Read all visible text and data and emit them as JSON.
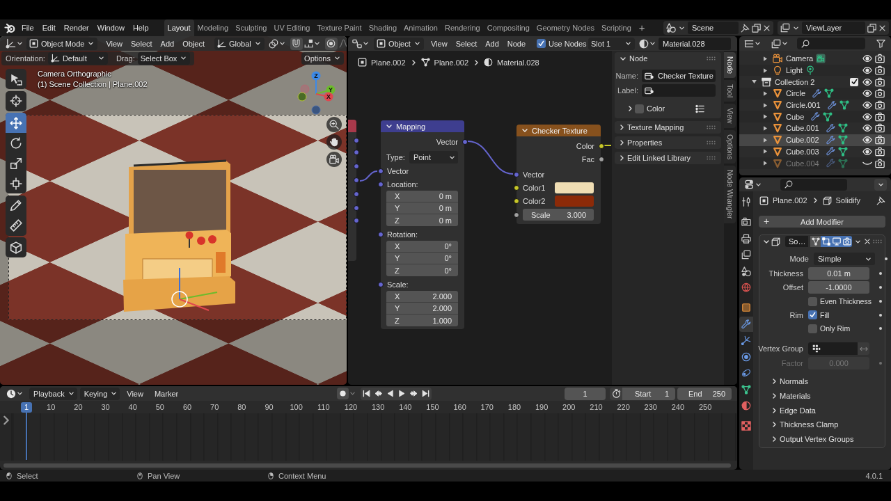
{
  "topbar": {
    "menus": [
      "File",
      "Edit",
      "Render",
      "Window",
      "Help"
    ],
    "workspaces": [
      {
        "label": "Layout",
        "selected": true
      },
      {
        "label": "Modeling",
        "selected": false
      },
      {
        "label": "Sculpting",
        "selected": false
      },
      {
        "label": "UV Editing",
        "selected": false
      },
      {
        "label": "Texture Paint",
        "selected": false
      },
      {
        "label": "Shading",
        "selected": false
      },
      {
        "label": "Animation",
        "selected": false
      },
      {
        "label": "Rendering",
        "selected": false
      },
      {
        "label": "Compositing",
        "selected": false
      },
      {
        "label": "Geometry Nodes",
        "selected": false
      },
      {
        "label": "Scripting",
        "selected": false
      }
    ],
    "add_workspace": "+",
    "scene": "Scene",
    "view_layer": "ViewLayer"
  },
  "viewport": {
    "header": {
      "mode": "Object Mode",
      "menus": [
        "View",
        "Select",
        "Add",
        "Object"
      ],
      "orientation": "Global"
    },
    "tool_settings": {
      "orientation_label": "Orientation:",
      "orientation": "Default",
      "drag_label": "Drag:",
      "drag": "Select Box",
      "options": "Options"
    },
    "overlay_text": [
      "Camera Orthographic",
      "(1) Scene Collection | Plane.002"
    ],
    "gizmo_axes": [
      "Z",
      "Y",
      "X"
    ],
    "tool_groups": [
      [
        {
          "kind": "select_box",
          "selected": false
        }
      ],
      [
        {
          "kind": "cursor",
          "selected": false
        }
      ],
      [
        {
          "kind": "move",
          "selected": true
        },
        {
          "kind": "rotate",
          "selected": false
        },
        {
          "kind": "scale",
          "selected": false
        },
        {
          "kind": "transform",
          "selected": false
        }
      ],
      [
        {
          "kind": "annotate",
          "selected": false
        },
        {
          "kind": "measure",
          "selected": false
        }
      ],
      [
        {
          "kind": "add_cube",
          "selected": false
        }
      ]
    ]
  },
  "node_editor": {
    "header": {
      "context": "Object",
      "menus": [
        "View",
        "Select",
        "Add",
        "Node"
      ],
      "use_nodes": {
        "label": "Use Nodes",
        "checked": true
      },
      "slot": "Slot 1",
      "material": "Material.028"
    },
    "breadcrumbs": [
      {
        "kind": "object",
        "label": "Plane.002"
      },
      {
        "kind": "mesh",
        "label": "Plane.002"
      },
      {
        "kind": "material",
        "label": "Material.028"
      }
    ],
    "nodes": [
      {
        "kind": "vector",
        "title": "Mapping",
        "expanded": true,
        "rows": [
          {
            "kind": "output",
            "label": "Vector",
            "socket": {
              "kind": "vector"
            }
          },
          {
            "kind": "dropdown",
            "label": "Type:",
            "value": "Point"
          },
          {
            "kind": "input",
            "label": "Vector",
            "socket": {
              "kind": "vector"
            }
          },
          {
            "kind": "vector_group",
            "label": "Location:",
            "socket": {
              "kind": "vector"
            },
            "fields": [
              {
                "axis": "X",
                "value": "0 m"
              },
              {
                "axis": "Y",
                "value": "0 m"
              },
              {
                "axis": "Z",
                "value": "0 m"
              }
            ]
          },
          {
            "kind": "vector_group",
            "label": "Rotation:",
            "socket": {
              "kind": "vector"
            },
            "fields": [
              {
                "axis": "X",
                "value": "0°"
              },
              {
                "axis": "Y",
                "value": "0°"
              },
              {
                "axis": "Z",
                "value": "0°"
              }
            ]
          },
          {
            "kind": "vector_group",
            "label": "Scale:",
            "socket": {
              "kind": "vector"
            },
            "fields": [
              {
                "axis": "X",
                "value": "2.000"
              },
              {
                "axis": "Y",
                "value": "2.000"
              },
              {
                "axis": "Z",
                "value": "1.000"
              }
            ]
          }
        ]
      },
      {
        "kind": "texture",
        "title": "Checker Texture",
        "expanded": true,
        "rows": [
          {
            "kind": "output",
            "label": "Color",
            "socket": {
              "kind": "color"
            }
          },
          {
            "kind": "output",
            "label": "Fac",
            "socket": {
              "kind": "float"
            }
          },
          {
            "kind": "input",
            "label": "Vector",
            "socket": {
              "kind": "vector"
            }
          },
          {
            "kind": "color_input",
            "label": "Color1",
            "socket": {
              "kind": "color"
            },
            "color": "#f0deb4"
          },
          {
            "kind": "color_input",
            "label": "Color2",
            "socket": {
              "kind": "color"
            },
            "color": "#8c2a08"
          },
          {
            "kind": "value_input",
            "label": "Scale",
            "value": "3.000",
            "socket": {
              "kind": "float"
            }
          }
        ]
      }
    ],
    "sidebar": {
      "node_panel": {
        "title": "Node",
        "expanded": true,
        "name_label": "Name:",
        "name": "Checker Texture",
        "label_label": "Label:",
        "color_panel": {
          "label": "Color",
          "expanded": false,
          "checked": false
        }
      },
      "panels": [
        {
          "title": "Texture Mapping",
          "expanded": false
        },
        {
          "title": "Properties",
          "expanded": false
        },
        {
          "title": "Edit Linked Library",
          "expanded": false
        }
      ]
    },
    "sidebar_tabs": [
      {
        "label": "Node",
        "selected": true
      },
      {
        "label": "Tool",
        "selected": false
      },
      {
        "label": "View",
        "selected": false
      },
      {
        "label": "Options",
        "selected": false
      },
      {
        "label": "Node Wrangler",
        "selected": false
      }
    ]
  },
  "outliner": {
    "items": [
      {
        "children": [
          {
            "name": "Camera",
            "kind": "camera",
            "expanded": false,
            "selected": false,
            "visible": true,
            "has_modifier": false
          },
          {
            "name": "Light",
            "kind": "light",
            "expanded": false,
            "selected": false,
            "visible": true,
            "has_modifier": false
          }
        ]
      },
      {
        "name": "Collection 2",
        "kind": "collection",
        "expanded": true,
        "checked": true,
        "selected": false,
        "visible": true,
        "has_modifier": false,
        "children": [
          {
            "name": "Circle",
            "kind": "mesh",
            "expanded": false,
            "selected": false,
            "visible": true,
            "has_modifier": true
          },
          {
            "name": "Circle.001",
            "kind": "mesh",
            "expanded": false,
            "selected": false,
            "visible": true,
            "has_modifier": true
          },
          {
            "name": "Cube",
            "kind": "mesh",
            "expanded": false,
            "selected": false,
            "visible": true,
            "has_modifier": true
          },
          {
            "name": "Cube.001",
            "kind": "mesh",
            "expanded": false,
            "selected": false,
            "visible": true,
            "has_modifier": true
          },
          {
            "name": "Cube.002",
            "kind": "mesh",
            "expanded": false,
            "selected": true,
            "visible": true,
            "has_modifier": true
          },
          {
            "name": "Cube.003",
            "kind": "mesh",
            "expanded": false,
            "selected": false,
            "visible": true,
            "has_modifier": true
          },
          {
            "name": "Cube.004",
            "kind": "mesh",
            "expanded": false,
            "selected": false,
            "visible": false,
            "has_modifier": true
          }
        ]
      }
    ]
  },
  "properties": {
    "tab_groups": [
      [
        {
          "kind": "tool",
          "selected": false
        }
      ],
      [
        {
          "kind": "render",
          "selected": false
        },
        {
          "kind": "output",
          "selected": false
        },
        {
          "kind": "view_layer",
          "selected": false
        },
        {
          "kind": "scene",
          "selected": false
        },
        {
          "kind": "world",
          "selected": false
        }
      ],
      [
        {
          "kind": "object",
          "selected": false
        },
        {
          "kind": "modifiers",
          "selected": true
        },
        {
          "kind": "particles",
          "selected": false
        },
        {
          "kind": "physics",
          "selected": false
        },
        {
          "kind": "constraints",
          "selected": false
        },
        {
          "kind": "data",
          "selected": false
        },
        {
          "kind": "material",
          "selected": false
        }
      ],
      [
        {
          "kind": "texture",
          "selected": false
        }
      ]
    ],
    "breadcrumbs": [
      {
        "kind": "object",
        "label": "Plane.002"
      },
      {
        "kind": "modifier",
        "label": "Solidify"
      }
    ],
    "add_modifier": {
      "icon": "+",
      "label": "Add Modifier"
    },
    "modifier": {
      "name": "So…",
      "expanded": true,
      "toggles": [
        {
          "kind": "on_cage",
          "on": false
        },
        {
          "kind": "edit_mode",
          "on": true
        },
        {
          "kind": "viewport",
          "on": true
        },
        {
          "kind": "render",
          "on": true
        }
      ],
      "fields": [
        {
          "kind": "dropdown",
          "label": "Mode",
          "value": "Simple",
          "disabled": false
        },
        {
          "kind": "number",
          "label": "Thickness",
          "value": "0.01 m",
          "disabled": false
        },
        {
          "kind": "number",
          "label": "Offset",
          "value": "-1.0000",
          "disabled": false
        },
        {
          "kind": "checkbox",
          "text": "Even Thickness",
          "checked": false,
          "disabled": false
        },
        {
          "kind": "checkbox",
          "label": "Rim",
          "text": "Fill",
          "checked": true,
          "disabled": false
        },
        {
          "kind": "checkbox",
          "text": "Only Rim",
          "checked": false,
          "disabled": false
        },
        {
          "kind": "vertex_group",
          "label": "Vertex Group",
          "disabled": false
        },
        {
          "kind": "number",
          "label": "Factor",
          "value": "0.000",
          "disabled": true
        }
      ],
      "subpanels": [
        {
          "title": "Normals",
          "expanded": false
        },
        {
          "title": "Materials",
          "expanded": false
        },
        {
          "title": "Edge Data",
          "expanded": false
        },
        {
          "title": "Thickness Clamp",
          "expanded": false
        },
        {
          "title": "Output Vertex Groups",
          "expanded": false
        }
      ]
    }
  },
  "timeline": {
    "menus": [
      {
        "label": "Playback",
        "kind": "dropdown"
      },
      {
        "label": "Keying",
        "kind": "dropdown"
      },
      {
        "label": "View",
        "kind": "menu"
      },
      {
        "label": "Marker",
        "kind": "menu"
      }
    ],
    "current_frame": "1",
    "start_label": "Start",
    "start": "1",
    "end_label": "End",
    "end": "250",
    "playhead": "1",
    "ruler": [
      "10",
      "20",
      "30",
      "40",
      "50",
      "60",
      "70",
      "80",
      "90",
      "100",
      "110",
      "120",
      "130",
      "140",
      "150",
      "160",
      "170",
      "180",
      "190",
      "200",
      "210",
      "220",
      "230",
      "240",
      "250"
    ]
  },
  "status_bar": {
    "hints": [
      {
        "kind": "mouse_left",
        "label": "Select"
      },
      {
        "kind": "mouse_middle",
        "label": "Pan View"
      },
      {
        "kind": "mouse_right",
        "label": "Context Menu"
      }
    ],
    "version": "4.0.1"
  }
}
